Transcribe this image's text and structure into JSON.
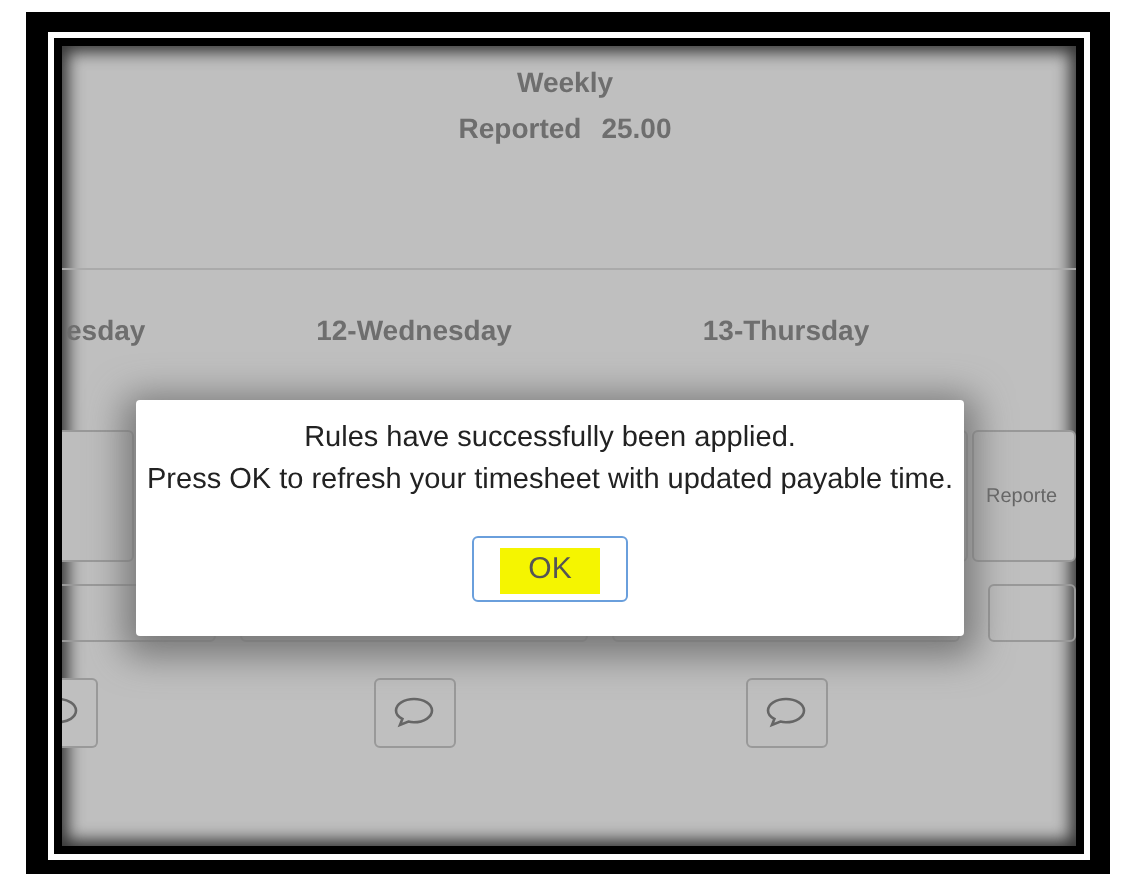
{
  "summary": {
    "title": "Weekly",
    "reported_label": "Reported",
    "reported_value": "25.00"
  },
  "days": [
    {
      "label": "esday"
    },
    {
      "label": "12-Wednesday"
    },
    {
      "label": "13-Thursday"
    }
  ],
  "side_tile": {
    "text": "Reporte"
  },
  "dialog": {
    "lines": [
      "Rules have successfully been applied.",
      "Press OK to refresh your timesheet with updated payable time."
    ],
    "button": "OK",
    "highlighted": true
  }
}
